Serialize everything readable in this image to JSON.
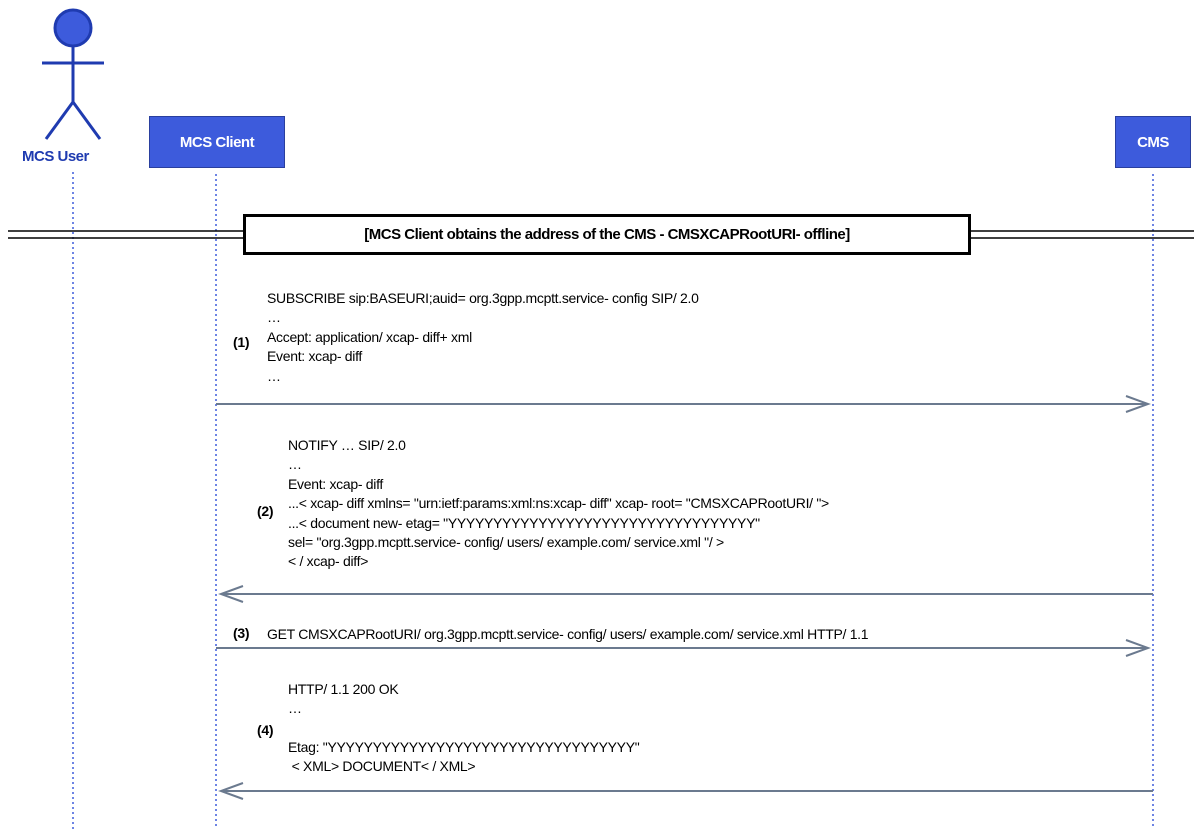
{
  "actors": {
    "user": {
      "label": "MCS User"
    },
    "client": {
      "label": "MCS Client"
    },
    "cms": {
      "label": "CMS"
    }
  },
  "frame": {
    "label": "[MCS Client obtains the address of the CMS - CMSXCAPRootURI- offline]"
  },
  "messages": [
    {
      "number": "(1)",
      "direction": "client-to-cms",
      "lines": [
        "SUBSCRIBE sip:BASEURI;auid= org.3gpp.mcptt.service- config SIP/ 2.0",
        "…",
        "Accept: application/ xcap- diff+ xml",
        "Event: xcap- diff",
        "…"
      ]
    },
    {
      "number": "(2)",
      "direction": "cms-to-client",
      "lines": [
        "NOTIFY … SIP/ 2.0",
        "…",
        "Event: xcap- diff",
        "...< xcap- diff xmlns= \"urn:ietf:params:xml:ns:xcap- diff\" xcap- root= \"CMSXCAPRootURI/ \">",
        "...< document new- etag= \"YYYYYYYYYYYYYYYYYYYYYYYYYYYYYYYYYY\"",
        "sel= \"org.3gpp.mcptt.service- config/ users/ example.com/ service.xml \"/ >",
        "< / xcap- diff>"
      ]
    },
    {
      "number": "(3)",
      "direction": "client-to-cms",
      "lines": [
        "GET CMSXCAPRootURI/ org.3gpp.mcptt.service- config/ users/ example.com/ service.xml HTTP/ 1.1"
      ]
    },
    {
      "number": "(4)",
      "direction": "cms-to-client",
      "lines": [
        "HTTP/ 1.1 200 OK",
        "…",
        "",
        "Etag: \"YYYYYYYYYYYYYYYYYYYYYYYYYYYYYYYYYY\"",
        " < XML> DOCUMENT< / XML>"
      ]
    }
  ],
  "colors": {
    "actor": "#1f3bb0",
    "actor_fill": "#3d5bdc",
    "lifeline": "#3d5bdc",
    "arrow": "#6b7a8f"
  }
}
